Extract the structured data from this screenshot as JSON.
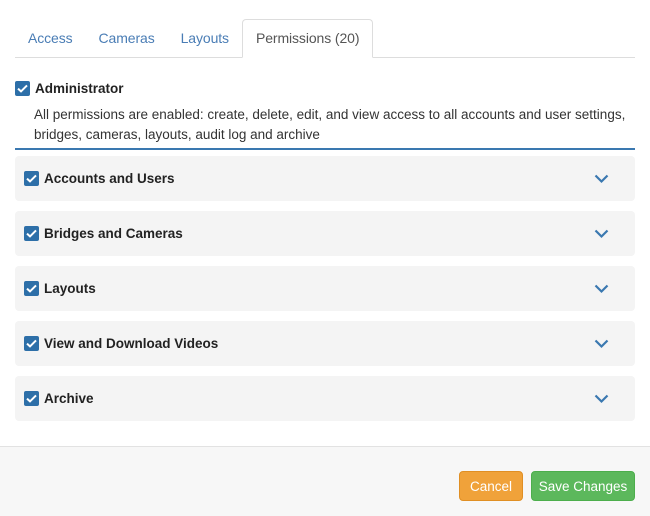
{
  "tabs": [
    {
      "label": "Access"
    },
    {
      "label": "Cameras"
    },
    {
      "label": "Layouts"
    },
    {
      "label": "Permissions (20)",
      "active": true
    }
  ],
  "admin": {
    "checked": true,
    "title": "Administrator",
    "description": "All permissions are enabled: create, delete, edit, and view access to all accounts and user settings, bridges, cameras, layouts, audit log and archive"
  },
  "sections": [
    {
      "label": "Accounts and Users",
      "checked": true
    },
    {
      "label": "Bridges and Cameras",
      "checked": true
    },
    {
      "label": "Layouts",
      "checked": true
    },
    {
      "label": "View and Download Videos",
      "checked": true
    },
    {
      "label": "Archive",
      "checked": true
    }
  ],
  "footer": {
    "cancel_label": "Cancel",
    "save_label": "Save Changes"
  },
  "icons": {
    "checkbox": "checkmark-icon",
    "expand": "chevron-down-icon"
  },
  "colors": {
    "link": "#4a7db5",
    "checkbox": "#2d6fa8",
    "cancel": "#f0a23a",
    "save": "#5cb85c"
  }
}
